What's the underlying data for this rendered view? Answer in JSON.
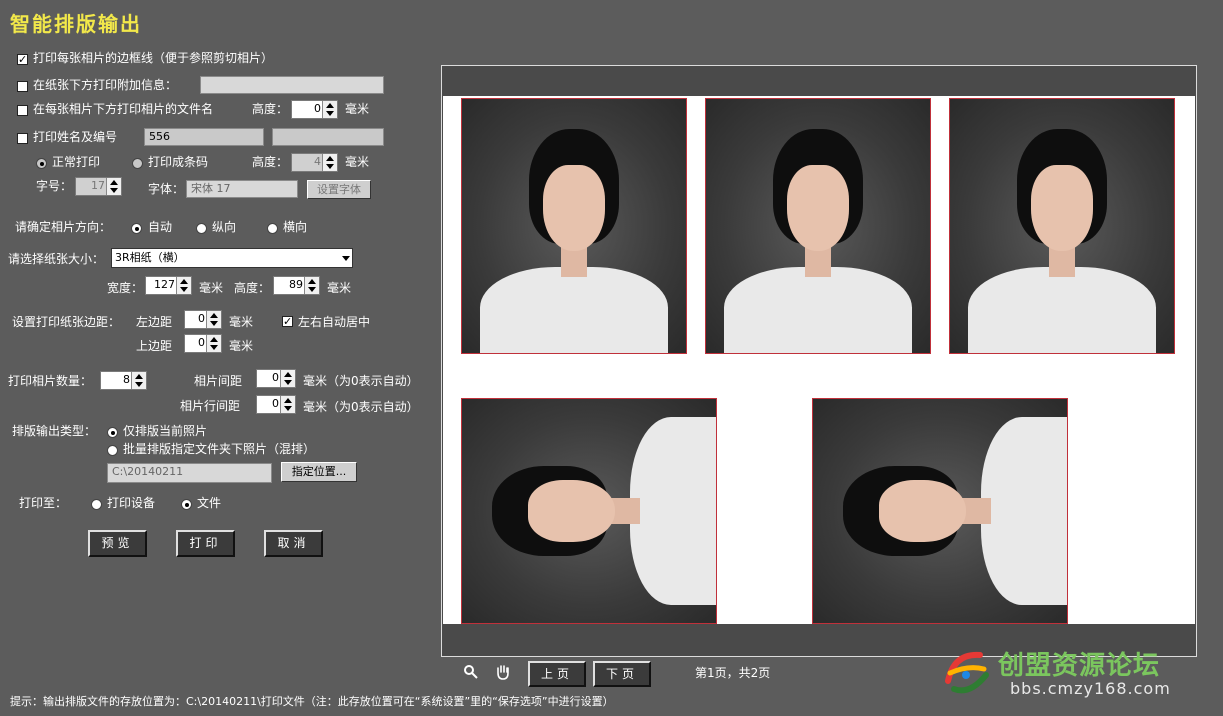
{
  "title": "智能排版输出",
  "options": {
    "print_border": "打印每张相片的边框线（便于参照剪切相片）",
    "print_info": "在纸张下方打印附加信息：",
    "print_filename": "在每张相片下方打印相片的文件名",
    "height_label": "高度：",
    "filename_height": "0",
    "mm": "毫米",
    "print_name": "打印姓名及编号",
    "name_value": "556",
    "normal_print": "正常打印",
    "barcode_print": "打印成条码",
    "barcode_height": "4",
    "font_size_label": "字号：",
    "font_size": "17",
    "font_label": "字体：",
    "font_value": "宋体 17",
    "set_font": "设置字体"
  },
  "orientation": {
    "label": "请确定相片方向：",
    "auto": "自动",
    "portrait": "纵向",
    "landscape": "横向"
  },
  "paper": {
    "label": "请选择纸张大小：",
    "selected": "3R相纸（横）",
    "width_label": "宽度：",
    "width": "127",
    "height_label": "高度：",
    "height": "89",
    "mm": "毫米"
  },
  "margins": {
    "label": "设置打印纸张边距：",
    "left_label": "左边距",
    "left": "0",
    "top_label": "上边距",
    "top": "0",
    "mm": "毫米",
    "center": "左右自动居中"
  },
  "count": {
    "label": "打印相片数量：",
    "value": "8",
    "gap_label": "相片间距",
    "gap": "0",
    "row_gap_label": "相片行间距",
    "row_gap": "0",
    "hint": "毫米（为0表示自动）"
  },
  "output_type": {
    "label": "排版输出类型：",
    "current": "仅排版当前照片",
    "batch": "批量排版指定文件夹下照片（混排）",
    "folder": "C:\\20140211",
    "choose": "指定位置..."
  },
  "print_to": {
    "label": "打印至：",
    "device": "打印设备",
    "file": "文件"
  },
  "buttons": {
    "preview": "预览",
    "print": "打印",
    "cancel": "取消",
    "prev": "上页",
    "next": "下页"
  },
  "page_info": "第1页，共2页",
  "status": "提示：输出排版文件的存放位置为：C:\\20140211\\打印文件（注：此存放位置可在“系统设置”里的“保存选项”中进行设置）",
  "watermark": {
    "text": "创盟资源论坛",
    "url": "bbs.cmzy168.com"
  }
}
